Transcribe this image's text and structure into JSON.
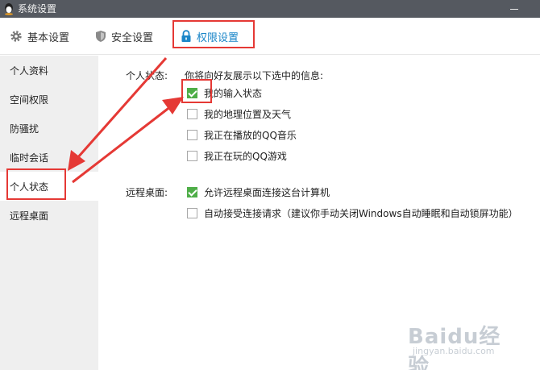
{
  "window": {
    "title": "系统设置"
  },
  "tabs": [
    {
      "label": "基本设置",
      "icon": "gear-icon"
    },
    {
      "label": "安全设置",
      "icon": "shield-icon"
    },
    {
      "label": "权限设置",
      "icon": "lock-icon",
      "active": true
    }
  ],
  "sidebar": {
    "items": [
      {
        "label": "个人资料"
      },
      {
        "label": "空间权限"
      },
      {
        "label": "防骚扰"
      },
      {
        "label": "临时会话"
      },
      {
        "label": "个人状态",
        "active": true
      },
      {
        "label": "远程桌面"
      }
    ]
  },
  "main": {
    "personal_status": {
      "label": "个人状态:",
      "description": "你将向好友展示以下选中的信息:",
      "options": [
        {
          "label": "我的输入状态",
          "checked": true
        },
        {
          "label": "我的地理位置及天气",
          "checked": false
        },
        {
          "label": "我正在播放的QQ音乐",
          "checked": false
        },
        {
          "label": "我正在玩的QQ游戏",
          "checked": false
        }
      ]
    },
    "remote_desktop": {
      "label": "远程桌面:",
      "options": [
        {
          "label": "允许远程桌面连接这台计算机",
          "checked": true
        },
        {
          "label": "自动接受连接请求（建议你手动关闭Windows自动睡眠和自动锁屏功能）",
          "checked": false
        }
      ]
    }
  },
  "watermark": {
    "text": "Baidu经验",
    "url": "jingyan.baidu.com"
  },
  "colors": {
    "accent": "#1b86c8",
    "highlight": "#e53935",
    "checkbox_checked": "#4fae48",
    "titlebar": "#555960"
  }
}
